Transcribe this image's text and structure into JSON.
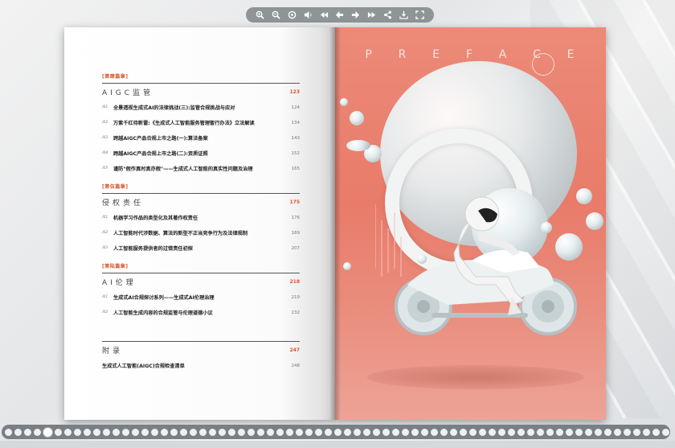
{
  "toolbar": {
    "buttons": [
      "zoom-in-icon",
      "zoom-out-icon",
      "zoom-reset-icon",
      "sound-icon",
      "first-page-icon",
      "prev-page-icon",
      "next-page-icon",
      "last-page-icon",
      "share-icon",
      "download-icon",
      "fullscreen-icon"
    ]
  },
  "toc": {
    "parts": [
      {
        "tag": "[第肆篇章]",
        "title": "AIGC监管",
        "page": "123",
        "entries": [
          {
            "num": "/01",
            "text": "全景透视生成式AI的法律挑战(三):监管合规挑战与应对",
            "page": "124"
          },
          {
            "num": "/02",
            "text": "万紫千红待新雷:《生成式人工智能服务管理暂行办法》立法解读",
            "page": "134"
          },
          {
            "num": "/03",
            "text": "跨越AIGC产品合规上市之路(一):算法备案",
            "page": "143"
          },
          {
            "num": "/04",
            "text": "跨越AIGC产品合规上市之路(二):资质证照",
            "page": "152"
          },
          {
            "num": "/05",
            "text": "谨防\"假作真时真亦假\"——生成式人工智能的真实性问题及治理",
            "page": "165"
          }
        ]
      },
      {
        "tag": "[第伍篇章]",
        "title": "侵权责任",
        "page": "175",
        "entries": [
          {
            "num": "/01",
            "text": "机器学习作品的类型化及其著作权责任",
            "page": "176"
          },
          {
            "num": "/02",
            "text": "人工智能时代涉数据、算法的新型不正当竞争行为及法律规制",
            "page": "189"
          },
          {
            "num": "/03",
            "text": "人工智能服务提供者的过错责任初探",
            "page": "207"
          }
        ]
      },
      {
        "tag": "[第陆篇章]",
        "title": "AI伦理",
        "page": "218",
        "entries": [
          {
            "num": "/01",
            "text": "生成式AI合规探讨系列——生成式AI伦理治理",
            "page": "219"
          },
          {
            "num": "/02",
            "text": "人工智能生成内容的合规监管与伦理道德小议",
            "page": "232"
          }
        ]
      }
    ],
    "appendix": {
      "title": "附录",
      "page": "247",
      "entries": [
        {
          "num": "",
          "text": "生成式人工智能(AIGC)合规检查清单",
          "page": "248"
        }
      ]
    }
  },
  "right_page": {
    "letters": [
      "P",
      "R",
      "E",
      "F",
      "A",
      "C",
      "E"
    ]
  },
  "thumbnails": {
    "count": 70,
    "active_index": 4
  },
  "colors": {
    "accent": "#d7562e",
    "page_bg": "#e97b6a"
  }
}
